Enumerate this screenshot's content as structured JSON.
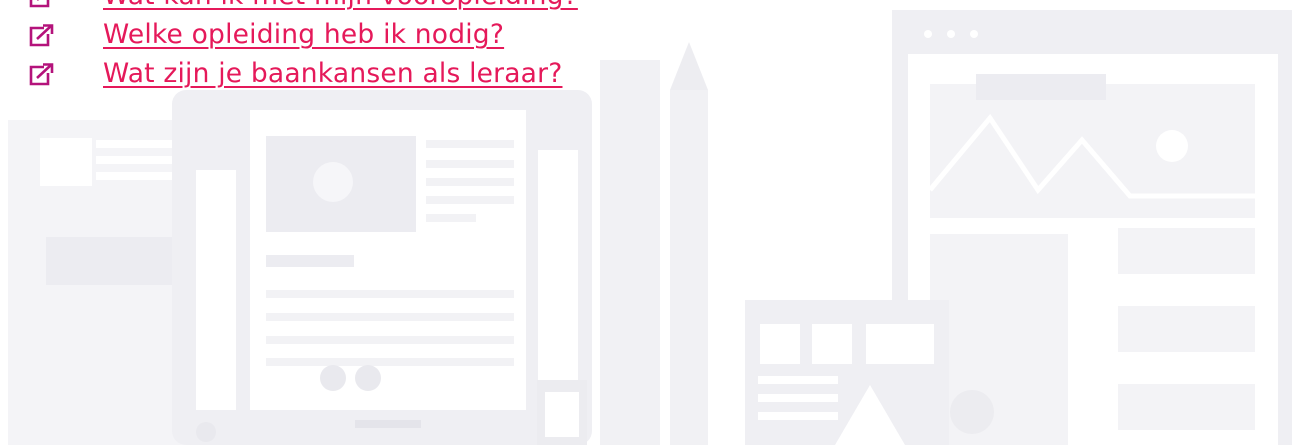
{
  "links": [
    {
      "label": "Wat kan ik met mijn vooropleiding?",
      "icon": "external-link-icon"
    },
    {
      "label": "Welke opleiding heb ik nodig?",
      "icon": "external-link-icon"
    },
    {
      "label": "Wat zijn je baankansen als leraar?",
      "icon": "external-link-icon"
    }
  ],
  "colors": {
    "link": "#e5195a",
    "icon": "#b4137b",
    "illustration": "#f3f3f6"
  }
}
